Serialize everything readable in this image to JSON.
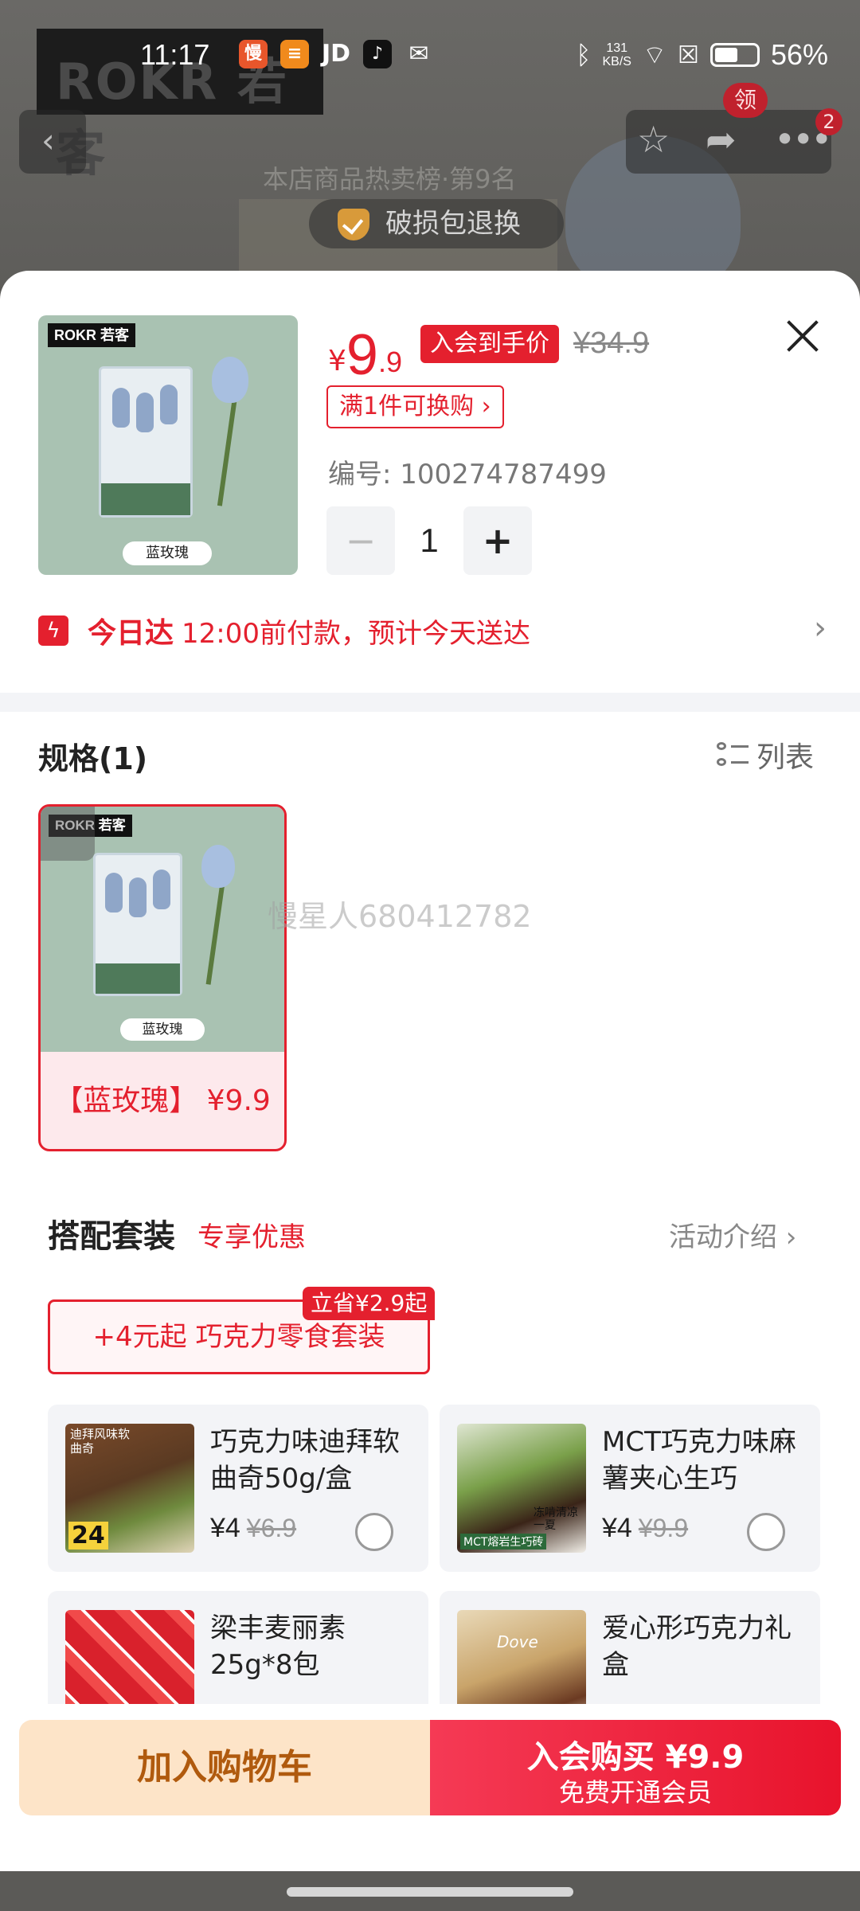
{
  "status": {
    "time": "11:17",
    "net_speed_value": "131",
    "net_speed_unit": "KB/S",
    "battery": "56%",
    "battery_level": 0.56
  },
  "background": {
    "logo": "ROKR 若客",
    "rank_text": "本店商品热卖榜·第9名",
    "guarantee": "破损包退换",
    "badge_ling": "领",
    "badge_count": "2"
  },
  "product": {
    "price_symbol": "¥",
    "price_int": "9",
    "price_dec": ".9",
    "member_tag": "入会到手价",
    "orig_price": "¥34.9",
    "swap_tag": "满1件可换购 ›",
    "sku_no": "编号: 100274787499",
    "quantity": "1",
    "minus": "−",
    "plus": "+",
    "image_logo": "ROKR 若客",
    "image_label": "蓝玫瑰"
  },
  "delivery": {
    "title": "今日达",
    "text": "12:00前付款，预计今天送达"
  },
  "spec": {
    "title": "规格(1)",
    "list_label": "列表",
    "items": [
      {
        "label": "【蓝玫瑰】 ¥9.9",
        "image_logo": "ROKR 若客",
        "image_label": "蓝玫瑰"
      }
    ]
  },
  "watermark": "慢星人680412782",
  "bundle": {
    "title": "搭配套装",
    "subtitle": "专享优惠",
    "activity": "活动介绍 ›",
    "pill": "+4元起 巧克力零食套装",
    "save_badge": "立省¥2.9起",
    "items": [
      {
        "name": "巧克力味迪拜软曲奇50g/盒",
        "price": "¥4",
        "orig": "¥6.9",
        "img_caption": "迪拜风味软曲奇",
        "img_num": "24"
      },
      {
        "name": "MCT巧克力味麻薯夹心生巧",
        "price": "¥4",
        "orig": "¥9.9",
        "img_caption": "MCT熔岩生巧砖",
        "img_num": "冻啃清凉一夏"
      },
      {
        "name": "梁丰麦丽素25g*8包",
        "price": "",
        "orig": ""
      },
      {
        "name": "爱心形巧克力礼盒",
        "price": "",
        "orig": "",
        "img_caption": "Dove"
      }
    ]
  },
  "actions": {
    "cart": "加入购物车",
    "buy_main": "入会购买 ¥9.9",
    "buy_sub": "免费开通会员"
  },
  "colors": {
    "accent": "#e4202e",
    "cart_bg": "#fde4c8",
    "cart_text": "#b05a0e"
  }
}
